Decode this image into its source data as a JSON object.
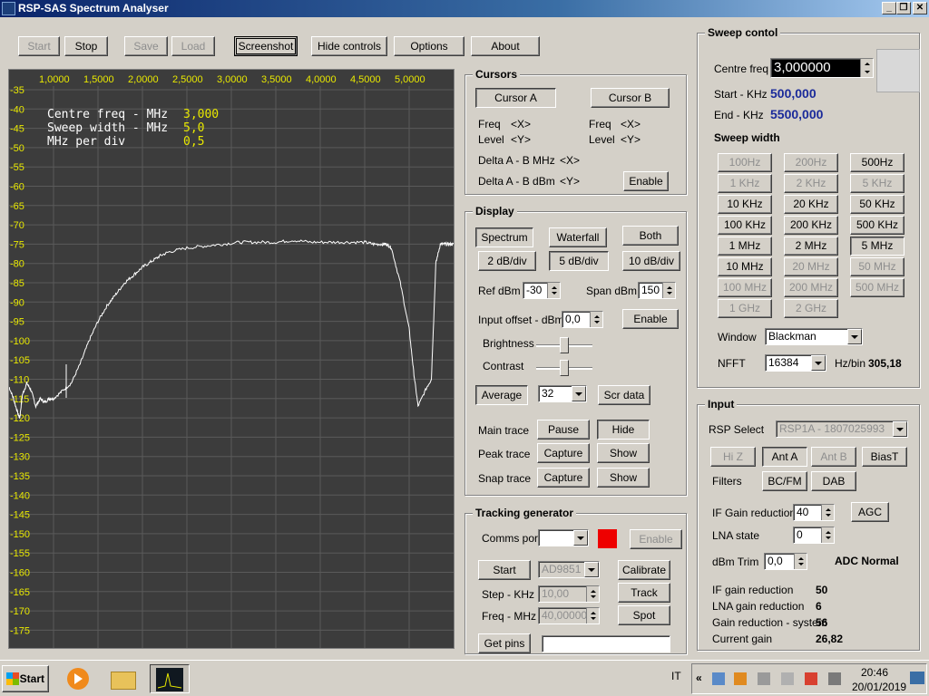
{
  "window": {
    "title": "RSP-SAS Spectrum Analyser",
    "minimize": "_",
    "maximize": "❐",
    "close": "✕"
  },
  "toolbar": {
    "start": "Start",
    "stop": "Stop",
    "save": "Save",
    "load": "Load",
    "screenshot": "Screenshot",
    "hide_controls": "Hide controls",
    "options": "Options",
    "about": "About"
  },
  "spectrum": {
    "info_lines": [
      {
        "label": "Centre freq  - MHz",
        "value": "3,000"
      },
      {
        "label": "Sweep width  - MHz",
        "value": "5,0"
      },
      {
        "label": "MHz per div",
        "value": "0,5"
      }
    ],
    "x_labels": [
      "1,0000",
      "1,5000",
      "2,0000",
      "2,5000",
      "3,0000",
      "3,5000",
      "4,0000",
      "4,5000",
      "5,0000"
    ],
    "y_labels": [
      "-35",
      "-40",
      "-45",
      "-50",
      "-55",
      "-60",
      "-65",
      "-70",
      "-75",
      "-80",
      "-85",
      "-90",
      "-95",
      "-100",
      "-105",
      "-110",
      "-115",
      "-120",
      "-125",
      "-130",
      "-135",
      "-140",
      "-145",
      "-150",
      "-155",
      "-160",
      "-165",
      "-170",
      "-175"
    ],
    "colors": {
      "background": "#3c3c3c",
      "grid": "#5a5a5a",
      "labels": "#e8e800",
      "info_text": "#ffffff",
      "trace": "#ffffff"
    }
  },
  "chart_data": {
    "type": "line",
    "xlabel": "",
    "ylabel": "",
    "xlim": [
      0.5,
      5.5
    ],
    "ylim": [
      -175,
      -35
    ],
    "x_ticks": [
      "1,0000",
      "1,5000",
      "2,0000",
      "2,5000",
      "3,0000",
      "3,5000",
      "4,0000",
      "4,5000",
      "5,0000"
    ],
    "series": [
      {
        "x": [
          0.5,
          0.55,
          0.6,
          0.62,
          0.65,
          0.7,
          0.75,
          0.8,
          0.85,
          0.9,
          0.95,
          1.0,
          1.1,
          1.2,
          1.3,
          1.4,
          1.5,
          1.6,
          1.7,
          1.8,
          1.9,
          2.0,
          2.1,
          2.2,
          2.3,
          2.5,
          2.7,
          2.9,
          3.1,
          3.3,
          3.5,
          3.7,
          3.9,
          4.1,
          4.3,
          4.5,
          4.6,
          4.7,
          4.75,
          4.8,
          4.9,
          5.0,
          5.05,
          5.1,
          5.2,
          5.25,
          5.3,
          5.35,
          5.4,
          5.45,
          5.5
        ],
        "y": [
          -112,
          -115,
          -119,
          -120,
          -114,
          -111,
          -113,
          -117,
          -115,
          -116,
          -115,
          -115,
          -113,
          -111,
          -106,
          -100,
          -95,
          -91,
          -88,
          -85,
          -83,
          -81,
          -79.5,
          -78,
          -77,
          -76,
          -75.5,
          -75,
          -74.5,
          -74.5,
          -74.5,
          -74,
          -74.5,
          -74.5,
          -74.5,
          -74.5,
          -75,
          -75,
          -75,
          -76,
          -85,
          -97,
          -108,
          -117,
          -112,
          -110,
          -80,
          -75,
          -75,
          -75,
          -75
        ]
      }
    ],
    "grid": true,
    "legend": "none"
  },
  "cursors": {
    "title": "Cursors",
    "cursor_a": "Cursor A",
    "cursor_b": "Cursor B",
    "freq_label": "Freq",
    "freq_value": "<X>",
    "level_label": "Level",
    "level_value": "<Y>",
    "delta_mhz_label": "Delta A - B MHz",
    "delta_mhz_value": "<X>",
    "delta_dbm_label": "Delta A - B dBm",
    "delta_dbm_value": "<Y>",
    "enable": "Enable"
  },
  "display": {
    "title": "Display",
    "spectrum": "Spectrum",
    "waterfall": "Waterfall",
    "both": "Both",
    "db2": "2 dB/div",
    "db5": "5 dB/div",
    "db10": "10 dB/div",
    "ref_label": "Ref dBm",
    "ref_value": "-30",
    "span_label": "Span dBm",
    "span_value": "150",
    "input_offset_label": "Input offset - dBm",
    "input_offset_value": "0,0",
    "enable": "Enable",
    "brightness": "Brightness",
    "contrast": "Contrast",
    "brightness_level": 0.5,
    "contrast_level": 0.5,
    "average": "Average",
    "average_value": "32",
    "scr_data": "Scr data",
    "main_trace": "Main trace",
    "pause": "Pause",
    "hide": "Hide",
    "peak_trace": "Peak trace",
    "capture": "Capture",
    "show": "Show",
    "snap_trace": "Snap trace"
  },
  "tracking": {
    "title": "Tracking generator",
    "comms_port": "Comms port",
    "enable": "Enable",
    "start": "Start",
    "device": "AD9851",
    "calibrate": "Calibrate",
    "step_label": "Step - KHz",
    "step_value": "10,00",
    "track": "Track",
    "freq_label": "Freq - MHz",
    "freq_value": "40,000000",
    "spot": "Spot",
    "get_pins": "Get pins",
    "indicator_color": "#ee0000"
  },
  "sweep_control": {
    "title": "Sweep contol",
    "centre_label": "Centre freq",
    "centre_value": "3,000000",
    "start_label": "Start - KHz",
    "start_value": "500,000",
    "end_label": "End - KHz",
    "end_value": "5500,000",
    "sweep_width": "Sweep width",
    "widths": [
      {
        "label": "100Hz",
        "enabled": false,
        "selected": false
      },
      {
        "label": "200Hz",
        "enabled": false,
        "selected": false
      },
      {
        "label": "500Hz",
        "enabled": true,
        "selected": false
      },
      {
        "label": "1 KHz",
        "enabled": false,
        "selected": false
      },
      {
        "label": "2 KHz",
        "enabled": false,
        "selected": false
      },
      {
        "label": "5 KHz",
        "enabled": false,
        "selected": false
      },
      {
        "label": "10 KHz",
        "enabled": true,
        "selected": false
      },
      {
        "label": "20 KHz",
        "enabled": true,
        "selected": false
      },
      {
        "label": "50 KHz",
        "enabled": true,
        "selected": false
      },
      {
        "label": "100 KHz",
        "enabled": true,
        "selected": false
      },
      {
        "label": "200 KHz",
        "enabled": true,
        "selected": false
      },
      {
        "label": "500 KHz",
        "enabled": true,
        "selected": false
      },
      {
        "label": "1 MHz",
        "enabled": true,
        "selected": false
      },
      {
        "label": "2 MHz",
        "enabled": true,
        "selected": false
      },
      {
        "label": "5 MHz",
        "enabled": true,
        "selected": true
      },
      {
        "label": "10 MHz",
        "enabled": true,
        "selected": false
      },
      {
        "label": "20 MHz",
        "enabled": false,
        "selected": false
      },
      {
        "label": "50 MHz",
        "enabled": false,
        "selected": false
      },
      {
        "label": "100 MHz",
        "enabled": false,
        "selected": false
      },
      {
        "label": "200 MHz",
        "enabled": false,
        "selected": false
      },
      {
        "label": "500 MHz",
        "enabled": false,
        "selected": false
      },
      {
        "label": "1 GHz",
        "enabled": false,
        "selected": false
      },
      {
        "label": "2 GHz",
        "enabled": false,
        "selected": false
      }
    ],
    "window_label": "Window",
    "window_value": "Blackman",
    "nfft_label": "NFFT",
    "nfft_value": "16384",
    "hzbin_label": "Hz/bin",
    "hzbin_value": "305,18"
  },
  "input": {
    "title": "Input",
    "rsp_select_label": "RSP Select",
    "rsp_select_value": "RSP1A - 1807025993",
    "hiz": "Hi Z",
    "ant_a": "Ant A",
    "ant_b": "Ant B",
    "biast": "BiasT",
    "filters_label": "Filters",
    "bcfm": "BC/FM",
    "dab": "DAB",
    "if_gain_label": "IF Gain reduction",
    "if_gain_value": "40",
    "agc": "AGC",
    "lna_label": "LNA state",
    "lna_value": "0",
    "dbm_trim_label": "dBm Trim",
    "dbm_trim_value": "0,0",
    "adc_status": "ADC Normal",
    "stats": [
      {
        "label": "IF gain reduction",
        "value": "50"
      },
      {
        "label": "LNA gain reduction",
        "value": "6"
      },
      {
        "label": "Gain reduction - system",
        "value": "56"
      },
      {
        "label": "Current gain",
        "value": "26,82"
      }
    ]
  },
  "taskbar": {
    "start": "Start",
    "language": "IT",
    "time": "20:46",
    "date": "20/01/2019"
  }
}
